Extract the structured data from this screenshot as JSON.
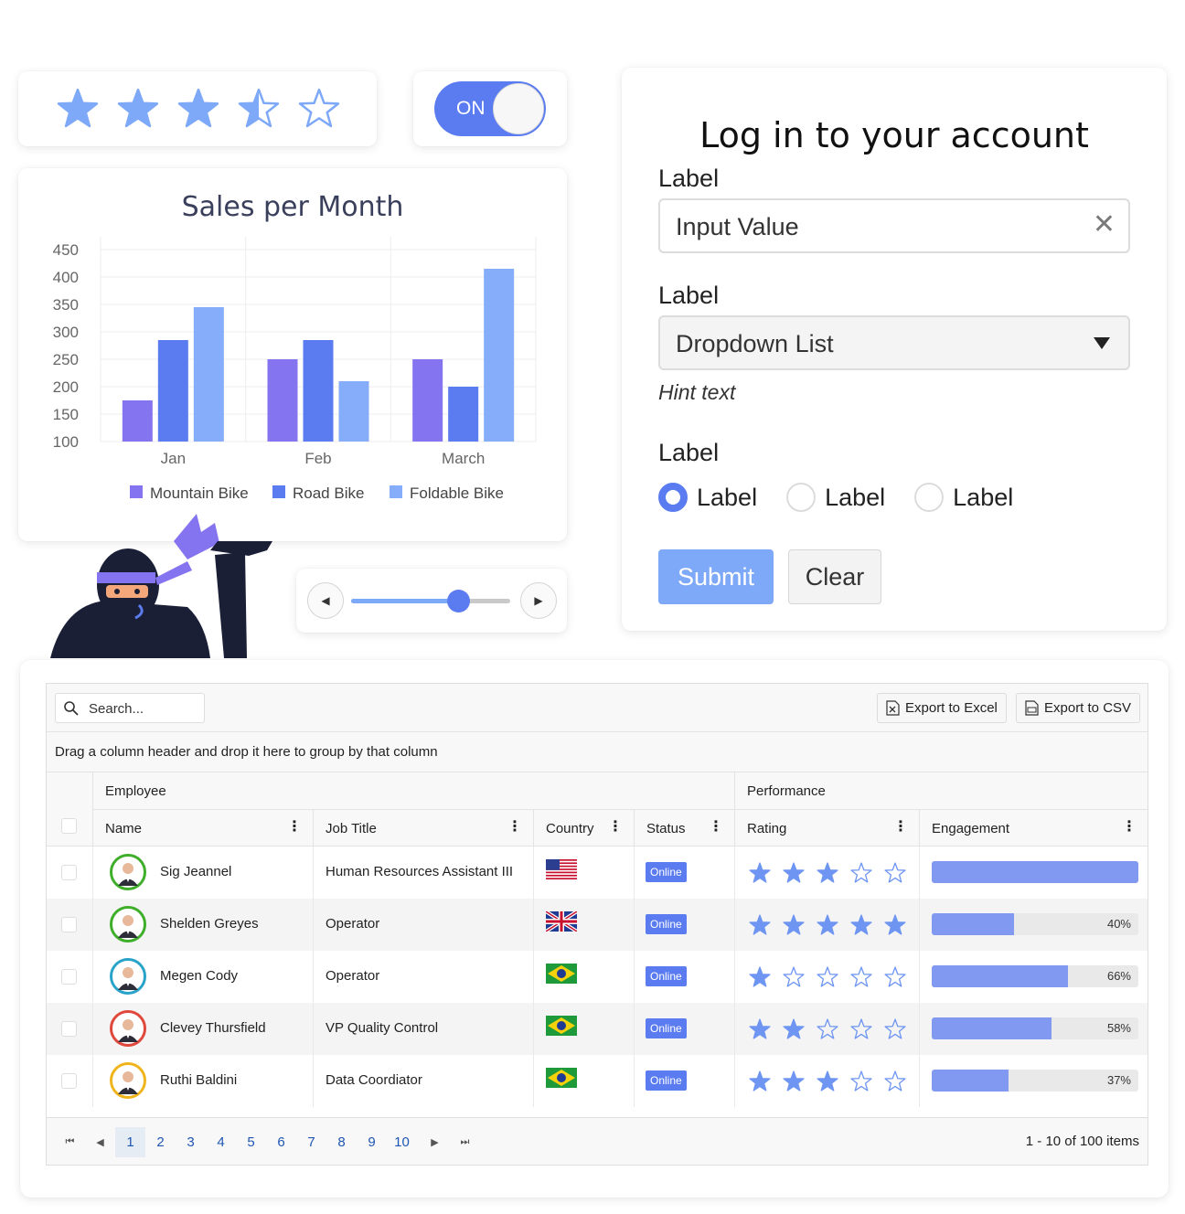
{
  "rating_widget": {
    "value": 3.5,
    "max": 5,
    "color": "#7ea8f8"
  },
  "toggle": {
    "label": "ON",
    "state": "on",
    "color": "#5b7cf0"
  },
  "chart_data": {
    "type": "bar",
    "title": "Sales per Month",
    "categories": [
      "Jan",
      "Feb",
      "March"
    ],
    "series": [
      {
        "name": "Mountain Bike",
        "color": "#8574f0",
        "values": [
          175,
          250,
          250
        ]
      },
      {
        "name": "Road Bike",
        "color": "#5b7cf0",
        "values": [
          285,
          285,
          200
        ]
      },
      {
        "name": "Foldable Bike",
        "color": "#86adfa",
        "values": [
          345,
          210,
          415
        ]
      }
    ],
    "ylim": [
      100,
      450
    ],
    "yticks": [
      100,
      150,
      200,
      250,
      300,
      350,
      400,
      450
    ],
    "grid": true,
    "legend_position": "bottom"
  },
  "slider": {
    "value": 0.67,
    "prev_icon": "triangle-left",
    "next_icon": "triangle-right"
  },
  "login": {
    "title": "Log in to your account",
    "input": {
      "label": "Label",
      "value": "Input Value"
    },
    "dropdown": {
      "label": "Label",
      "value": "Dropdown List",
      "hint": "Hint text"
    },
    "radios": {
      "label": "Label",
      "options": [
        "Label",
        "Label",
        "Label"
      ],
      "selected": 0
    },
    "submit_label": "Submit",
    "clear_label": "Clear"
  },
  "grid": {
    "search_placeholder": "Search...",
    "export_excel": "Export to Excel",
    "export_csv": "Export to CSV",
    "group_hint": "Drag a column header and drop it here to group by that column",
    "group_headers": {
      "employee": "Employee",
      "performance": "Performance"
    },
    "columns": {
      "name": "Name",
      "job": "Job Title",
      "country": "Country",
      "status": "Status",
      "rating": "Rating",
      "engagement": "Engagement"
    },
    "rows": [
      {
        "name": "Sig Jeannel",
        "job": "Human Resources Assistant III",
        "country": "us",
        "status": "Online",
        "rating": 3,
        "engagement": 100,
        "engagement_label": "",
        "avatar_ring": "#3fae2a"
      },
      {
        "name": "Shelden Greyes",
        "job": "Operator",
        "country": "gb",
        "status": "Online",
        "rating": 5,
        "engagement": 40,
        "engagement_label": "40%",
        "avatar_ring": "#3fae2a"
      },
      {
        "name": "Megen Cody",
        "job": "Operator",
        "country": "br",
        "status": "Online",
        "rating": 1,
        "engagement": 66,
        "engagement_label": "66%",
        "avatar_ring": "#2aa3c9"
      },
      {
        "name": "Clevey Thursfield",
        "job": "VP Quality Control",
        "country": "br",
        "status": "Online",
        "rating": 2,
        "engagement": 58,
        "engagement_label": "58%",
        "avatar_ring": "#e0483c"
      },
      {
        "name": "Ruthi Baldini",
        "job": "Data Coordiator",
        "country": "br",
        "status": "Online",
        "rating": 3,
        "engagement": 37,
        "engagement_label": "37%",
        "avatar_ring": "#f0b41d"
      }
    ],
    "pager": {
      "pages": [
        "1",
        "2",
        "3",
        "4",
        "5",
        "6",
        "7",
        "8",
        "9",
        "10"
      ],
      "current": "1",
      "info": "1 - 10 of 100 items"
    }
  }
}
